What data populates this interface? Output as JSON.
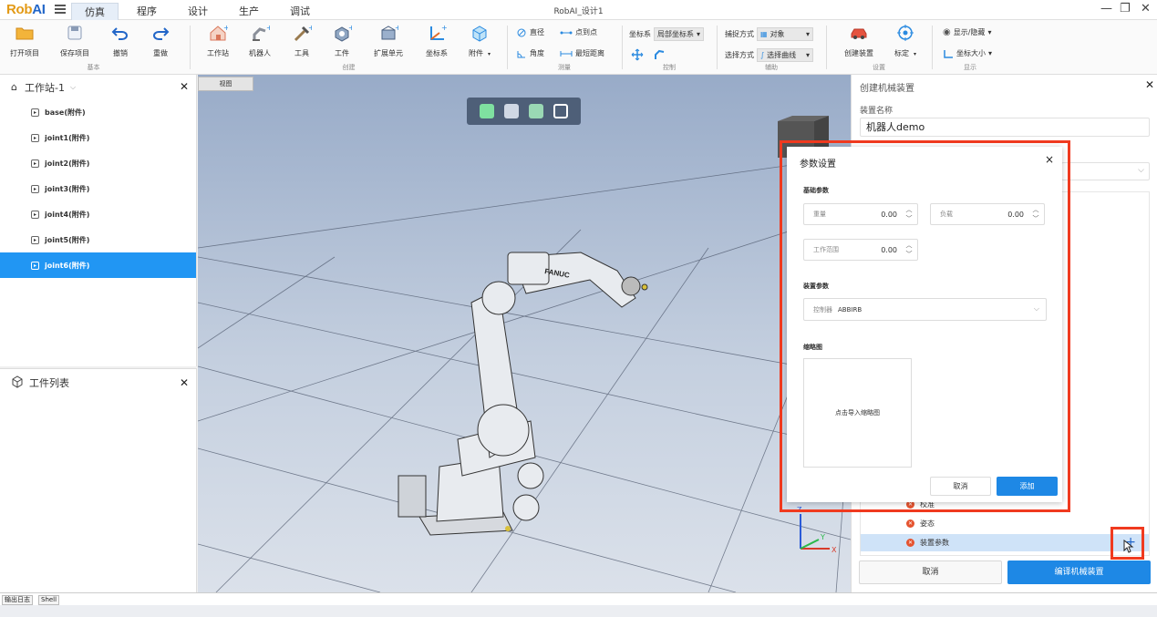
{
  "app": {
    "logo_rob": "Rob",
    "logo_ai": "AI",
    "title": "RobAI_设计1",
    "menu_tabs": [
      "仿真",
      "程序",
      "设计",
      "生产",
      "调试"
    ],
    "active_tab": "仿真",
    "window_controls": [
      "—",
      "❐",
      "✕"
    ]
  },
  "ribbon": {
    "buttons": [
      {
        "label": "打开项目",
        "icon": "folder-icon"
      },
      {
        "label": "保存项目",
        "icon": "save-icon"
      },
      {
        "label": "撤销",
        "icon": "undo-icon"
      },
      {
        "label": "重做",
        "icon": "redo-icon"
      },
      {
        "label": "工作站",
        "icon": "workstation-icon"
      },
      {
        "label": "机器人",
        "icon": "robot-icon"
      },
      {
        "label": "工具",
        "icon": "tool-icon"
      },
      {
        "label": "工件",
        "icon": "workpiece-icon"
      },
      {
        "label": "扩展单元",
        "icon": "extension-icon"
      },
      {
        "label": "坐标系",
        "icon": "coordinate-icon"
      },
      {
        "label": "附件",
        "icon": "attachment-icon"
      },
      {
        "label": "创建装置",
        "icon": "create-device-icon"
      },
      {
        "label": "标定",
        "icon": "calibrate-icon"
      }
    ],
    "groups": [
      "基本",
      "创建",
      "测量",
      "控制",
      "辅助",
      "设置",
      "显示"
    ],
    "measure": {
      "diameter": "直径",
      "point_to_point": "点到点",
      "angle": "角度",
      "min_distance": "最短距离"
    },
    "control": {
      "coord_label": "坐标系",
      "coord_value": "局部坐标系"
    },
    "assist": {
      "capture_label": "捕捉方式",
      "capture_value": "对象",
      "select_label": "选择方式",
      "select_value": "选择曲线"
    },
    "display": {
      "show_hide": "显示/隐藏",
      "coord_size": "坐标大小"
    }
  },
  "tree": {
    "title": "工作站-1",
    "items": [
      {
        "label": "base(附件)",
        "selected": false
      },
      {
        "label": "joint1(附件)",
        "selected": false
      },
      {
        "label": "joint2(附件)",
        "selected": false
      },
      {
        "label": "joint3(附件)",
        "selected": false
      },
      {
        "label": "joint4(附件)",
        "selected": false
      },
      {
        "label": "joint5(附件)",
        "selected": false
      },
      {
        "label": "joint6(附件)",
        "selected": true
      }
    ]
  },
  "parts": {
    "title": "工件列表"
  },
  "viewport": {
    "tab": "视图",
    "axes": {
      "x": "X",
      "y": "Y",
      "z": "Z"
    },
    "robot_brand": "FANUC"
  },
  "right_panel": {
    "title": "创建机械装置",
    "name_label": "装置名称",
    "name_value": "机器人demo",
    "rows": [
      {
        "label": "校准",
        "highlight": false
      },
      {
        "label": "姿态",
        "highlight": false
      },
      {
        "label": "装置参数",
        "highlight": true
      }
    ],
    "plus": "+",
    "cancel": "取消",
    "compile": "编译机械装置"
  },
  "dialog": {
    "title": "参数设置",
    "close": "×",
    "basic_section": "基础参数",
    "weight_label": "重量",
    "weight_value": "0.00",
    "load_label": "负载",
    "load_value": "0.00",
    "range_label": "工作范围",
    "range_value": "0.00",
    "device_section": "装置参数",
    "controller_label": "控制器",
    "controller_value": "ABBIRB",
    "thumb_section": "缩略图",
    "thumb_hint": "点击导入缩略图",
    "cancel": "取消",
    "add": "添加"
  },
  "bottom": {
    "tabs": [
      "输出日志",
      "Shell"
    ]
  },
  "colors": {
    "accent": "#1e88e5",
    "annotation": "#f03a1f",
    "logo_orange": "#e39a16"
  }
}
